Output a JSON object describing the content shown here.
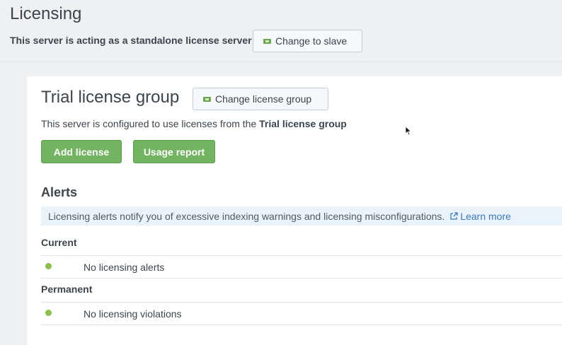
{
  "page": {
    "title": "Licensing",
    "server_status": "This server is acting as a standalone license server",
    "change_to_slave_label": "Change to slave"
  },
  "license_group": {
    "title": "Trial license group",
    "change_group_label": "Change license group",
    "desc_prefix": "This server is configured to use licenses from the ",
    "desc_group": "Trial license group",
    "add_license_label": "Add license",
    "usage_report_label": "Usage report"
  },
  "alerts": {
    "heading": "Alerts",
    "info_text": "Licensing alerts notify you of excessive indexing warnings and licensing misconfigurations.",
    "learn_more_label": "Learn more",
    "current_label": "Current",
    "current_message": "No licensing alerts",
    "permanent_label": "Permanent",
    "permanent_message": "No licensing violations"
  },
  "icons": {
    "ticket": "license-ticket-icon",
    "external_link": "external-link-icon",
    "status_ok": "status-dot-icon",
    "cursor": "mouse-cursor-icon"
  },
  "colors": {
    "primary_button": "#72b462",
    "link": "#3b7bbf",
    "info_bar": "#eaf3f9",
    "status_ok": "#8bbf4a"
  }
}
